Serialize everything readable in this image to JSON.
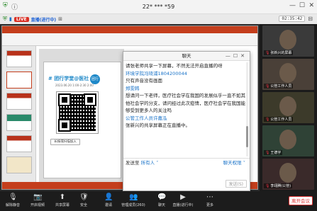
{
  "window": {
    "title": "22* *** *59",
    "min": "—",
    "max": "☐",
    "close": "✕"
  },
  "status": {
    "live_badge": "LIVE",
    "live_text": "直播(进行中)",
    "timer": "02:35:42"
  },
  "slide": {
    "heading": "# 团行学堂@医社",
    "date": "2023.06.20 1:00-2:30 2:00",
    "scan_button": "长按或扫描加入",
    "logo": "团行"
  },
  "chat": {
    "title": "聊天",
    "messages": [
      {
        "type": "text",
        "text": "请张老师共享一下屏幕，不然无法开启直播的呀"
      },
      {
        "type": "sender",
        "text": "环境学院冯琦浦1804200044"
      },
      {
        "type": "text",
        "text": "只有声音没有画面"
      },
      {
        "type": "sender",
        "text": "郑雯韩"
      },
      {
        "type": "text",
        "text": "想请问一下老师，医疗社会学在我国的发展似乎一直不如其他社会学的分支，请问经过此次疫情，医疗社会学在我国能够受到更多人的关注吗"
      },
      {
        "type": "sender",
        "text": "公管工作人员许嘉泓"
      },
      {
        "type": "text",
        "text": "张新兴的共享屏幕正在直播中。"
      }
    ],
    "send_to_label": "发送至",
    "send_to_target": "所有人 ˅",
    "permission": "聊天权限 ˅",
    "send_button": "发送(S)"
  },
  "gallery": {
    "tiles": [
      {
        "label": "张新兴的屏幕",
        "color": "#3a3a3a"
      },
      {
        "label": "公管工作人员",
        "color": "#4a4038"
      },
      {
        "label": "公管工作人员",
        "color": "#3c3a2a"
      },
      {
        "label": "王德宇",
        "color": "#2f4236"
      },
      {
        "label": "李翊腾(公管)",
        "color": "#3a2a2a"
      }
    ]
  },
  "toolbar": {
    "items": [
      {
        "label": "解除静音",
        "icon": "🎙"
      },
      {
        "label": "开启视频",
        "icon": "📷"
      },
      {
        "label": "共享屏幕",
        "icon": "⬆"
      },
      {
        "label": "安全",
        "icon": "🛡"
      },
      {
        "label": "邀请",
        "icon": "👤"
      },
      {
        "label": "管理成员(260)",
        "icon": "👥"
      },
      {
        "label": "聊天",
        "icon": "💬"
      },
      {
        "label": "直播(进行中)",
        "icon": "▶"
      },
      {
        "label": "更多",
        "icon": "⋯"
      }
    ],
    "leave": "离开会议"
  }
}
